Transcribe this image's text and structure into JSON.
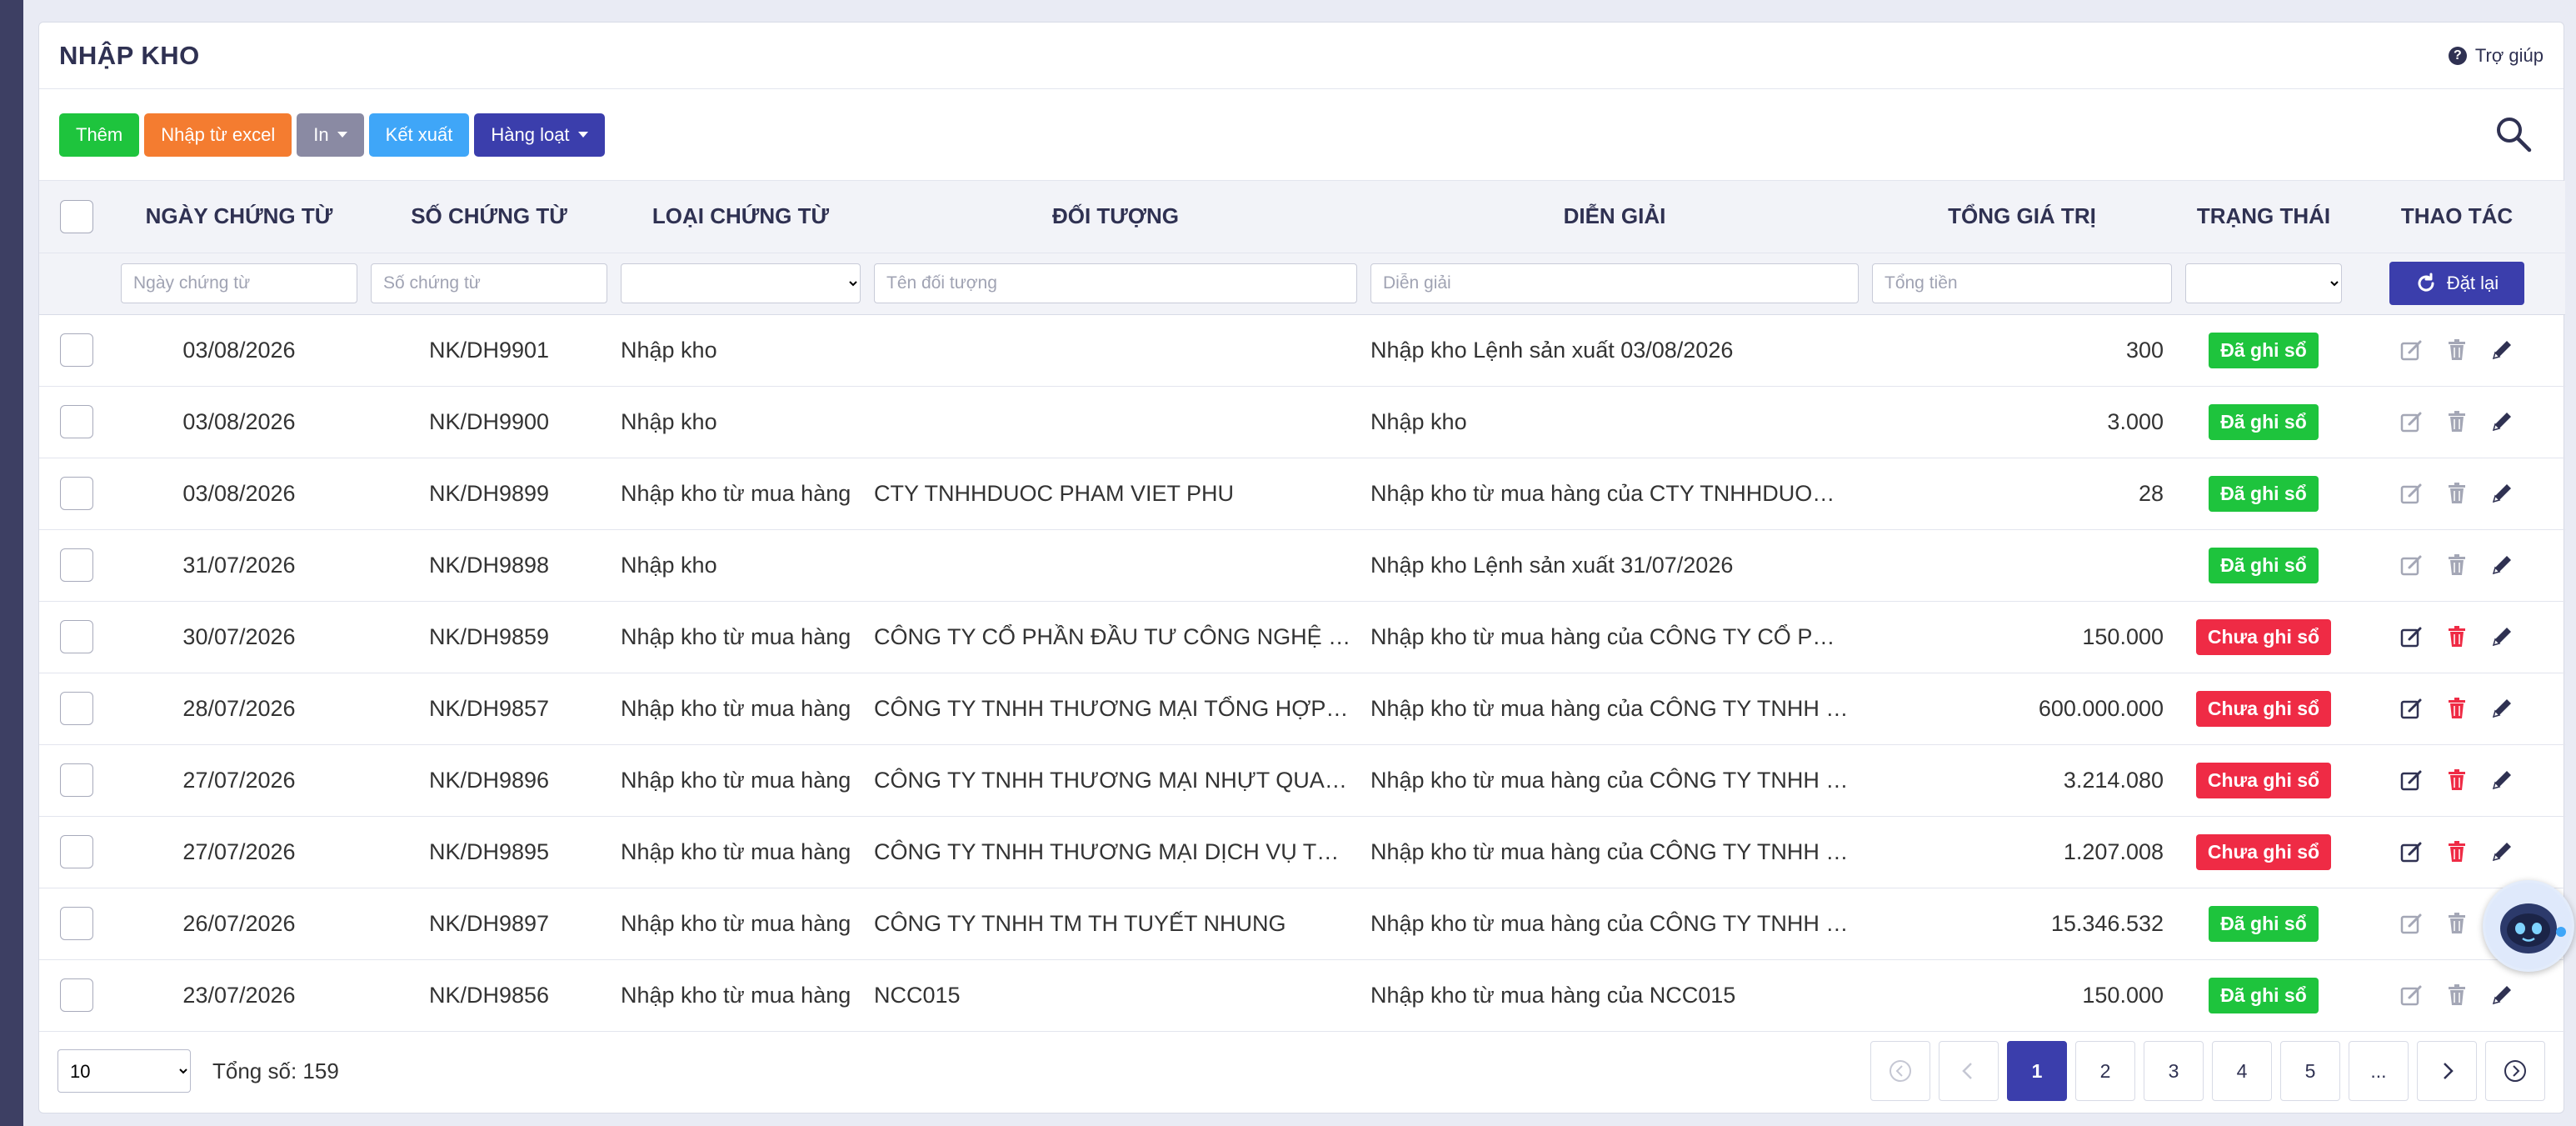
{
  "page": {
    "title": "NHẬP KHO",
    "help_label": "Trợ giúp"
  },
  "colors": {
    "navy": "#3b3eac",
    "green": "#1ec43d",
    "red": "#ef2b45",
    "orange": "#f47c30",
    "blue": "#3fa6f8",
    "gray": "#8a8aa3"
  },
  "toolbar": {
    "add_label": "Thêm",
    "import_excel_label": "Nhập từ excel",
    "print_label": "In",
    "export_label": "Kết xuất",
    "batch_label": "Hàng loạt",
    "search_icon": "search-icon"
  },
  "table": {
    "columns": [
      "NGÀY CHỨNG TỪ",
      "SỐ CHỨNG TỪ",
      "LOẠI CHỨNG TỪ",
      "ĐỐI TƯỢNG",
      "DIỄN GIẢI",
      "TỔNG GIÁ TRỊ",
      "TRẠNG THÁI",
      "THAO TÁC"
    ],
    "filters": {
      "date_placeholder": "Ngày chứng từ",
      "number_placeholder": "Số chứng từ",
      "partner_placeholder": "Tên đối tượng",
      "description_placeholder": "Diễn giải",
      "total_placeholder": "Tổng tiền",
      "reset_label": "Đặt lại"
    },
    "rows": [
      {
        "date": "03/08/2026",
        "number": "NK/DH9901",
        "type": "Nhập kho",
        "partner": "",
        "description": "Nhập kho Lệnh sản xuất 03/08/2026",
        "total": "300",
        "status": "Đã ghi sổ",
        "status_type": "posted"
      },
      {
        "date": "03/08/2026",
        "number": "NK/DH9900",
        "type": "Nhập kho",
        "partner": "",
        "description": "Nhập kho",
        "total": "3.000",
        "status": "Đã ghi sổ",
        "status_type": "posted"
      },
      {
        "date": "03/08/2026",
        "number": "NK/DH9899",
        "type": "Nhập kho từ mua hàng",
        "partner": "CTY TNHHDUOC PHAM VIET PHU",
        "description": "Nhập kho từ mua hàng của CTY TNHHDUO…",
        "total": "28",
        "status": "Đã ghi sổ",
        "status_type": "posted"
      },
      {
        "date": "31/07/2026",
        "number": "NK/DH9898",
        "type": "Nhập kho",
        "partner": "",
        "description": "Nhập kho Lệnh sản xuất 31/07/2026",
        "total": "",
        "status": "Đã ghi sổ",
        "status_type": "posted"
      },
      {
        "date": "30/07/2026",
        "number": "NK/DH9859",
        "type": "Nhập kho từ mua hàng",
        "partner": "CÔNG TY CỔ PHẦN ĐẦU TƯ CÔNG NGHỆ …",
        "description": "Nhập kho từ mua hàng của CÔNG TY CỔ P…",
        "total": "150.000",
        "status": "Chưa ghi sổ",
        "status_type": "unposted"
      },
      {
        "date": "28/07/2026",
        "number": "NK/DH9857",
        "type": "Nhập kho từ mua hàng",
        "partner": "CÔNG TY TNHH THƯƠNG MẠI TỔNG HỢP…",
        "description": "Nhập kho từ mua hàng của CÔNG TY TNHH …",
        "total": "600.000.000",
        "status": "Chưa ghi sổ",
        "status_type": "unposted"
      },
      {
        "date": "27/07/2026",
        "number": "NK/DH9896",
        "type": "Nhập kho từ mua hàng",
        "partner": "CÔNG TY TNHH THƯƠNG MẠI NHỰT QUA…",
        "description": "Nhập kho từ mua hàng của CÔNG TY TNHH …",
        "total": "3.214.080",
        "status": "Chưa ghi sổ",
        "status_type": "unposted"
      },
      {
        "date": "27/07/2026",
        "number": "NK/DH9895",
        "type": "Nhập kho từ mua hàng",
        "partner": "CÔNG TY TNHH THƯƠNG MẠI DỊCH VỤ T…",
        "description": "Nhập kho từ mua hàng của CÔNG TY TNHH …",
        "total": "1.207.008",
        "status": "Chưa ghi sổ",
        "status_type": "unposted"
      },
      {
        "date": "26/07/2026",
        "number": "NK/DH9897",
        "type": "Nhập kho từ mua hàng",
        "partner": "CÔNG TY TNHH TM TH TUYẾT NHUNG",
        "description": "Nhập kho từ mua hàng của CÔNG TY TNHH …",
        "total": "15.346.532",
        "status": "Đã ghi sổ",
        "status_type": "posted"
      },
      {
        "date": "23/07/2026",
        "number": "NK/DH9856",
        "type": "Nhập kho từ mua hàng",
        "partner": "NCC015",
        "description": "Nhập kho từ mua hàng của NCC015",
        "total": "150.000",
        "status": "Đã ghi sổ",
        "status_type": "posted"
      }
    ],
    "row_actions": [
      "edit-icon",
      "trash-icon",
      "pencil-icon"
    ]
  },
  "footer": {
    "page_size": "10",
    "total_label": "Tổng số: 159",
    "pages": [
      "1",
      "2",
      "3",
      "4",
      "5",
      "..."
    ],
    "current_page": "1"
  }
}
